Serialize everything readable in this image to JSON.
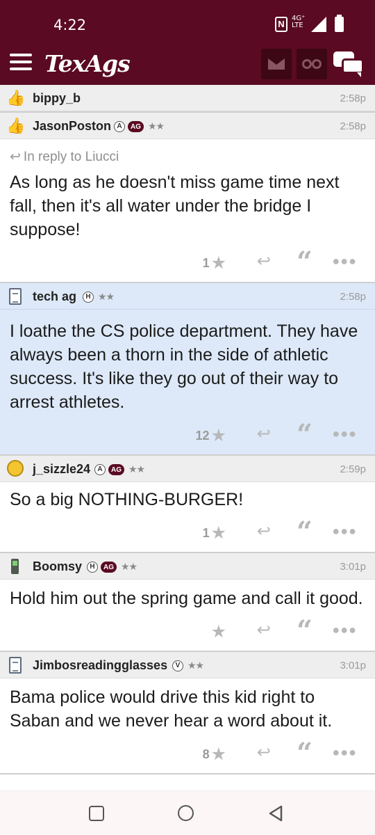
{
  "status_bar": {
    "time": "4:22",
    "network_top": "4G⁺",
    "network_bottom": "LTE"
  },
  "header": {
    "logo": "TexAgs",
    "icons": {
      "menu": "hamburger-menu-icon",
      "messages": "envelope-icon",
      "watch": "binoculars-icon",
      "chat": "chat-bubbles-icon"
    },
    "colors": {
      "maroon": "#5a0a22",
      "dark_maroon": "#3d0716"
    }
  },
  "posts": [
    {
      "username": "bippy_b",
      "avatar": "thumbs-up-icon",
      "badges": [],
      "stars": "",
      "time": "2:58p",
      "reply_to": "",
      "body": "",
      "likes": "",
      "highlighted": false,
      "partial": true
    },
    {
      "username": "JasonPoston",
      "avatar": "thumbs-up-icon",
      "badges": [
        "A",
        "AG"
      ],
      "stars": "★★",
      "time": "2:58p",
      "reply_to": "In reply to Liucci",
      "body": "As long as he doesn't miss game time next fall, then it's all water under the bridge I suppose!",
      "likes": "1",
      "highlighted": false
    },
    {
      "username": "tech ag",
      "avatar": "document-icon",
      "badges": [
        "H"
      ],
      "stars": "★★",
      "time": "2:58p",
      "reply_to": "",
      "body": "I loathe the CS police department. They have always been a thorn in the side of athletic success. It's like they go out of their way to arrest athletes.",
      "likes": "12",
      "highlighted": true
    },
    {
      "username": "j_sizzle24",
      "avatar": "smiley-icon",
      "badges": [
        "A",
        "AG"
      ],
      "stars": "★★",
      "time": "2:59p",
      "reply_to": "",
      "body": "So a big NOTHING-BURGER!",
      "likes": "1",
      "highlighted": false
    },
    {
      "username": "Boomsy",
      "avatar": "phone-icon",
      "badges": [
        "H",
        "AG"
      ],
      "stars": "★★",
      "time": "3:01p",
      "reply_to": "",
      "body": "Hold him out the spring game and call it good.",
      "likes": "",
      "highlighted": false
    },
    {
      "username": "Jimbosreadingglasses",
      "avatar": "document-icon",
      "badges": [
        "V"
      ],
      "stars": "★★",
      "time": "3:01p",
      "reply_to": "",
      "body": "Bama police would drive this kid right to Saban and we never hear a word about it.",
      "likes": "8",
      "highlighted": false
    }
  ],
  "post_actions": {
    "star": "★",
    "reply": "reply-arrow-icon",
    "quote": "quote-icon",
    "more": "more-dots-icon"
  },
  "nav_bar": {
    "recents": "square-icon",
    "home": "circle-icon",
    "back": "triangle-back-icon"
  }
}
